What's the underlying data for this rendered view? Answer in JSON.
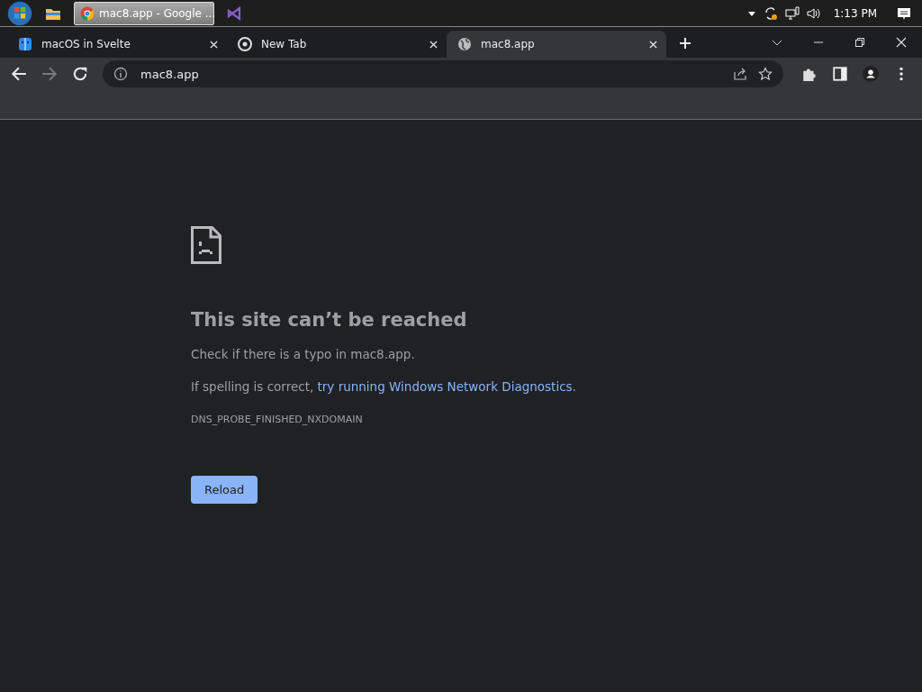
{
  "taskbar": {
    "tasks": [
      {
        "kind": "explorer"
      },
      {
        "kind": "chrome",
        "title": "mac8.app - Google ..."
      },
      {
        "kind": "studio"
      }
    ],
    "clock": "1:13 PM"
  },
  "tabs": [
    {
      "kind": "finder",
      "title": "macOS in Svelte",
      "selected": false
    },
    {
      "kind": "chrome",
      "title": "New Tab",
      "selected": false
    },
    {
      "kind": "globe",
      "title": "mac8.app",
      "selected": true
    }
  ],
  "address": {
    "value": "mac8.app"
  },
  "error": {
    "heading": "This site can’t be reached",
    "hint": "Check if there is a typo in mac8.app.",
    "suggestion_prefix": "If spelling is correct, ",
    "suggestion_link": "try running Windows Network Diagnostics",
    "suggestion_suffix": ".",
    "code": "DNS_PROBE_FINISHED_NXDOMAIN",
    "button": "Reload"
  }
}
